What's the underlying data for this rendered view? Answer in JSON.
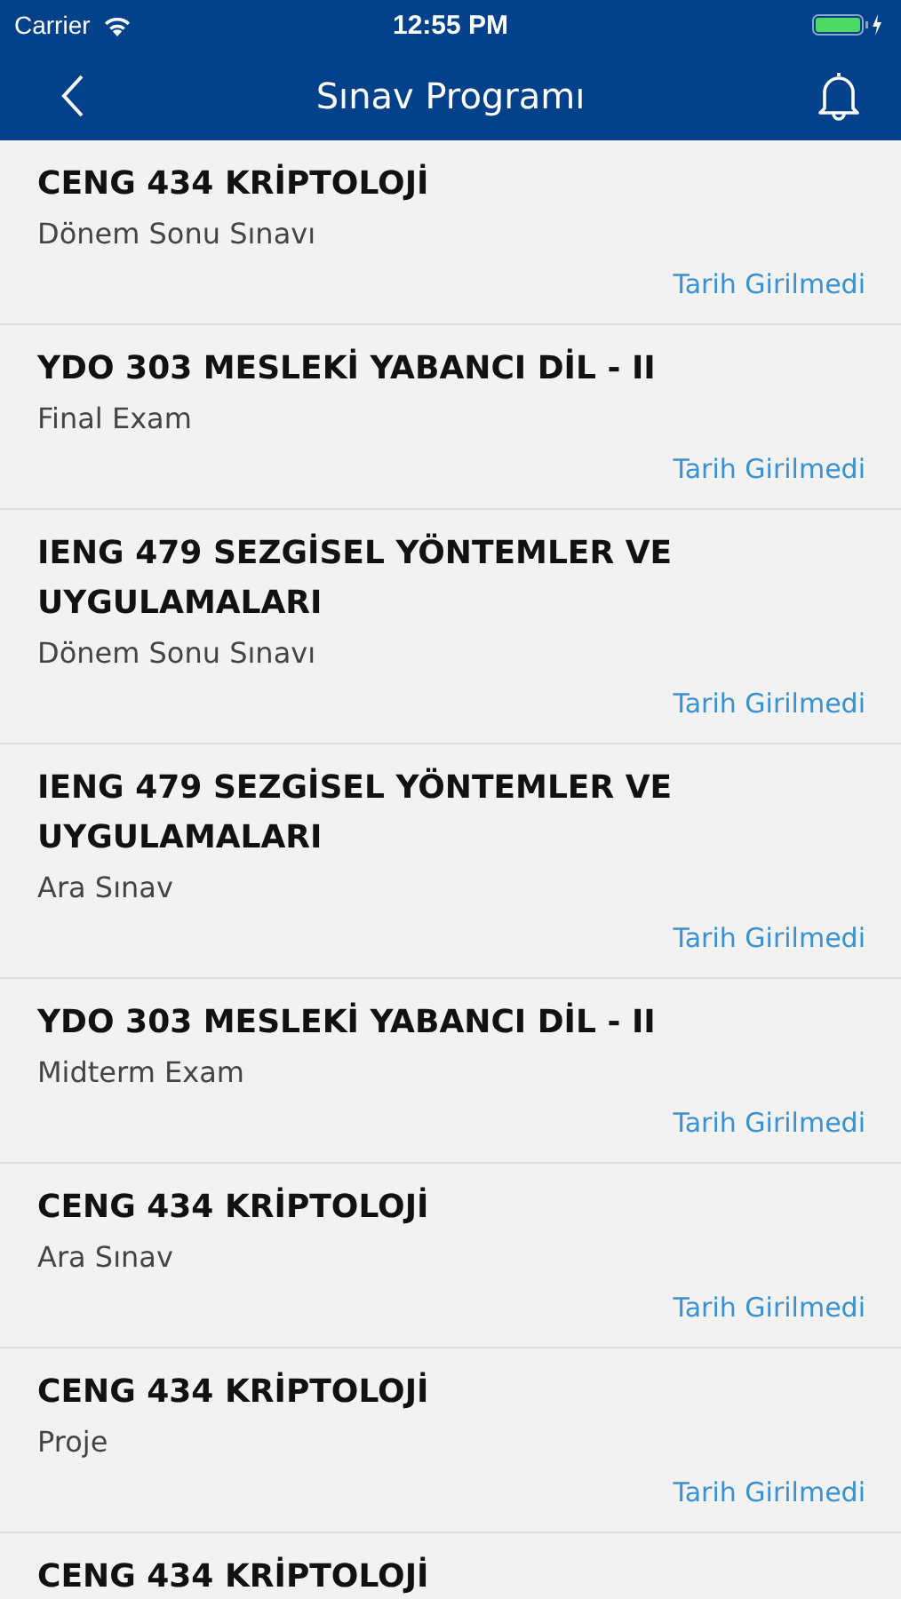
{
  "status_bar": {
    "carrier": "Carrier",
    "time": "12:55 PM"
  },
  "nav_bar": {
    "title": "Sınav Programı"
  },
  "exams": [
    {
      "course": "CENG 434 KRİPTOLOJİ",
      "type": "Dönem Sonu Sınavı",
      "date": "Tarih Girilmedi"
    },
    {
      "course": "YDO 303 MESLEKİ YABANCI DİL - II",
      "type": "Final Exam",
      "date": "Tarih Girilmedi"
    },
    {
      "course": "IENG 479 SEZGİSEL YÖNTEMLER VE UYGULAMALARI",
      "type": "Dönem Sonu Sınavı",
      "date": "Tarih Girilmedi"
    },
    {
      "course": "IENG 479 SEZGİSEL YÖNTEMLER VE UYGULAMALARI",
      "type": "Ara Sınav",
      "date": "Tarih Girilmedi"
    },
    {
      "course": "YDO 303 MESLEKİ YABANCI DİL - II",
      "type": "Midterm Exam",
      "date": "Tarih Girilmedi"
    },
    {
      "course": "CENG 434 KRİPTOLOJİ",
      "type": "Ara Sınav",
      "date": "Tarih Girilmedi"
    },
    {
      "course": "CENG 434 KRİPTOLOJİ",
      "type": "Proje",
      "date": "Tarih Girilmedi"
    },
    {
      "course": "CENG 434 KRİPTOLOJİ"
    }
  ]
}
